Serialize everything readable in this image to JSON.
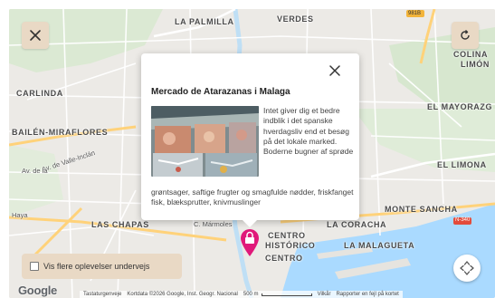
{
  "map": {
    "labels": [
      {
        "id": "la-palmilla",
        "text": "LA PALMILLA"
      },
      {
        "id": "verdes",
        "text": "VERDES"
      },
      {
        "id": "carlinda",
        "text": "CARLINDA"
      },
      {
        "id": "bailen-miraflores",
        "text": "BAILÉN-MIRAFLORES"
      },
      {
        "id": "colina",
        "text": "COLINA"
      },
      {
        "id": "limon",
        "text": "LIMÓN"
      },
      {
        "id": "el-mayorazgo",
        "text": "EL MAYORAZG"
      },
      {
        "id": "el-limonar",
        "text": "EL LIMONA"
      },
      {
        "id": "monte-sancha",
        "text": "MONTE SANCHA"
      },
      {
        "id": "las-chapas",
        "text": "LAS CHAPAS"
      },
      {
        "id": "la-coracha",
        "text": "LA CORACHA"
      },
      {
        "id": "la-malagueta",
        "text": "LA MALAGUETA"
      },
      {
        "id": "centro-historico-1",
        "text": "CENTRO"
      },
      {
        "id": "centro-historico-2",
        "text": "HISTÓRICO"
      },
      {
        "id": "centro",
        "text": "CENTRO"
      }
    ],
    "road_labels": [
      {
        "id": "av-valle-inclan",
        "text": "Av. de Valle-Inclán"
      },
      {
        "id": "av-de-la",
        "text": "Av. de la"
      },
      {
        "id": "haya",
        "text": "Haya"
      },
      {
        "id": "c-marmoles",
        "text": "C. Mármoles"
      },
      {
        "id": "n-340",
        "text": "N-340"
      },
      {
        "id": "road-981b",
        "text": "981B"
      }
    ]
  },
  "controls": {
    "close_icon": "close-icon",
    "reset_icon": "refresh-icon",
    "locate_icon": "crosshair-icon"
  },
  "popup": {
    "title": "Mercado de Atarazanas i Malaga",
    "description_wrapped": "Intet giver dig et bedre indblik i det spanske hverdagsliv end et besøg på det lokale marked. Boderne bugner af sprøde",
    "description_full": "grøntsager, saftige frugter og smagfulde nødder, friskfanget fisk, blæksprutter, knivmuslinger",
    "close_icon": "close-icon"
  },
  "checkbox": {
    "label": "Vis flere oplevelser undervejs",
    "checked": false
  },
  "footer": {
    "google": "Google",
    "shortcuts": "Tastaturgenveje",
    "mapdata": "Kortdata ©2026 Google, Inst. Geogr. Nacional",
    "scale": "500 m",
    "terms": "Vilkår",
    "report": "Rapporter en fejl på kortet"
  },
  "colors": {
    "button_bg": "#e9d9c5",
    "pin": "#e0197a",
    "map_bg": "#eceae6",
    "water": "#aadaff",
    "road_main": "#ffd27a"
  }
}
